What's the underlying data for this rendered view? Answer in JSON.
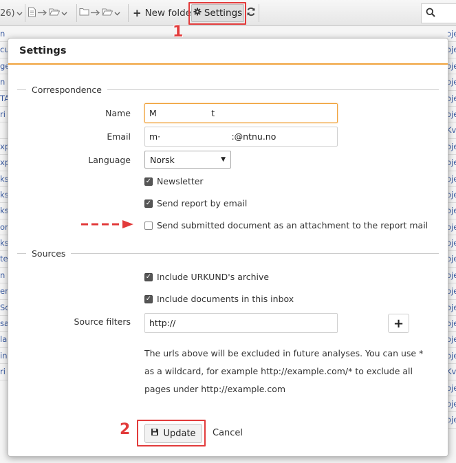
{
  "toolbar": {
    "count_text": "26)",
    "new_folder_label": "New folder",
    "settings_label": "Settings"
  },
  "background_list": {
    "left": [
      "n",
      "cu",
      "ge",
      "n",
      "TA",
      "ri",
      "",
      "xp",
      "xp",
      "ks",
      "ks",
      "ks",
      "or",
      "ks",
      "te",
      "n",
      "er",
      "Sc",
      "sa",
      "la",
      "in",
      "ri"
    ],
    "right": [
      "oje",
      "oje",
      "oje",
      "oje",
      "oje",
      "oje",
      "Kv",
      "oje",
      "oje",
      "oje",
      "oje",
      "oje",
      "oje",
      "oje",
      "oje",
      "oje",
      "oje",
      "oje",
      "oje",
      "oje",
      "oje",
      "Kv",
      "oje",
      "oje",
      "oje"
    ]
  },
  "modal": {
    "title": "Settings",
    "correspondence": {
      "legend": "Correspondence",
      "name_label": "Name",
      "name_value": "M                    t",
      "email_label": "Email",
      "email_value": "m·                          :@ntnu.no",
      "language_label": "Language",
      "language_value": "Norsk",
      "newsletter_label": "Newsletter",
      "newsletter_checked": true,
      "send_report_label": "Send report by email",
      "send_report_checked": true,
      "attach_label": "Send submitted document as an attachment to the report mail",
      "attach_checked": false
    },
    "sources": {
      "legend": "Sources",
      "urkund_label": "Include URKUND's archive",
      "urkund_checked": true,
      "inbox_label": "Include documents in this inbox",
      "inbox_checked": true,
      "filters_label": "Source filters",
      "filters_value": "http://",
      "add_button_label": "+",
      "help_text": "The urls above will be excluded in future analyses. You can use * as a wildcard, for example http://example.com/* to exclude all pages under http://example.com"
    },
    "update_label": "Update",
    "cancel_label": "Cancel"
  },
  "annotations": {
    "num1": "1",
    "num2": "2",
    "color": "#e23b3b"
  }
}
